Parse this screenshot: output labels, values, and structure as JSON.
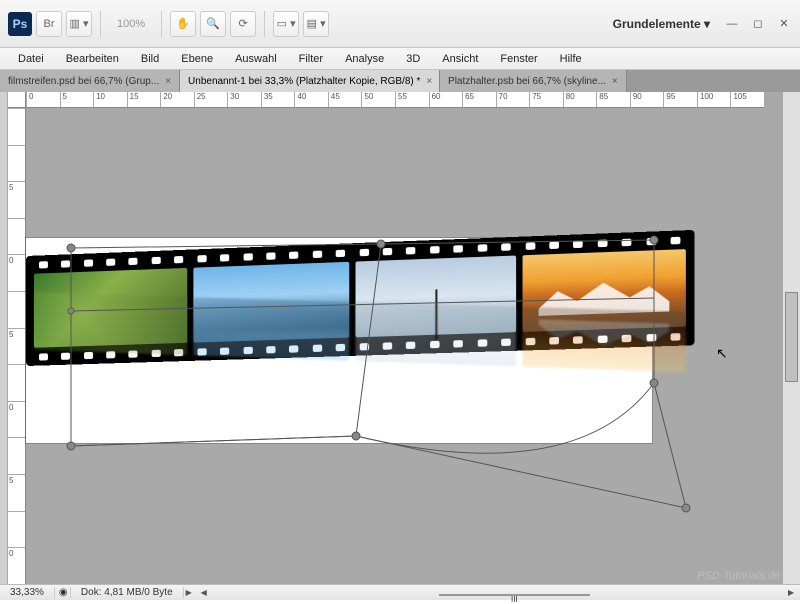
{
  "workspace": {
    "label": "Grundelemente"
  },
  "titlebar": {
    "zoom": "100%",
    "br_label": "Br"
  },
  "menu": {
    "items": [
      "Datei",
      "Bearbeiten",
      "Bild",
      "Ebene",
      "Auswahl",
      "Filter",
      "Analyse",
      "3D",
      "Ansicht",
      "Fenster",
      "Hilfe"
    ]
  },
  "tabs": [
    {
      "label": "filmstreifen.psd bei 66,7% (Grup...",
      "active": false
    },
    {
      "label": "Unbenannt-1 bei 33,3% (Platzhalter Kopie, RGB/8) *",
      "active": true
    },
    {
      "label": "Platzhalter.psb bei 66,7% (skyline...",
      "active": false
    }
  ],
  "rulers": {
    "h": [
      "0",
      "5",
      "10",
      "15",
      "20",
      "25",
      "30",
      "35",
      "40",
      "45",
      "50",
      "55",
      "60",
      "65",
      "70",
      "75",
      "80",
      "85",
      "90",
      "95",
      "100",
      "105"
    ],
    "v": [
      "",
      "",
      "5",
      "",
      "0",
      "",
      "5",
      "",
      "0",
      "",
      "5",
      "",
      "0"
    ]
  },
  "status": {
    "zoom": "33,33%",
    "doc": "Dok: 4,81 MB/0 Byte"
  },
  "watermark": "PSD-Tutorials.de",
  "scroll_label": "III"
}
